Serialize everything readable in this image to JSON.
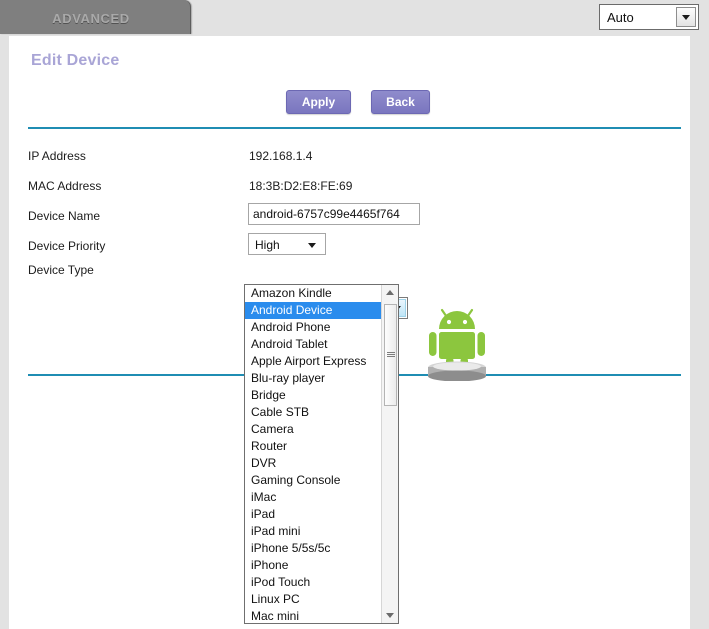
{
  "topbar": {
    "tab_label": "ADVANCED",
    "language_select": {
      "value": "Auto",
      "icon": "chevron-down-icon"
    }
  },
  "page": {
    "title": "Edit Device"
  },
  "toolbar": {
    "apply_label": "Apply",
    "back_label": "Back"
  },
  "form": {
    "rows": [
      {
        "label": "IP Address",
        "value": "192.168.1.4"
      },
      {
        "label": "MAC Address",
        "value": "18:3B:D2:E8:FE:69"
      },
      {
        "label": "Device Name",
        "value": "android-6757c99e4465f764"
      },
      {
        "label": "Device Priority",
        "value": "High"
      },
      {
        "label": "Device Type",
        "value": "Android Device"
      }
    ],
    "device_name_input": {
      "value": "android-6757c99e4465f764",
      "placeholder": ""
    },
    "device_priority_select": {
      "value": "High"
    },
    "device_type_select": {
      "value": "Android Device",
      "expanded": true,
      "options": [
        "Amazon Kindle",
        "Android Device",
        "Android Phone",
        "Android Tablet",
        "Apple Airport Express",
        "Blu-ray player",
        "Bridge",
        "Cable STB",
        "Camera",
        "Router",
        "DVR",
        "Gaming Console",
        "iMac",
        "iPad",
        "iPad mini",
        "iPhone 5/5s/5c",
        "iPhone",
        "iPod Touch",
        "Linux PC",
        "Mac mini"
      ],
      "selected_index": 1
    }
  },
  "device_image": {
    "icon": "android-robot-pedestal-icon",
    "body_color": "#8cc63e",
    "pedestal_color": "#9e9e9e"
  },
  "colors": {
    "accent_rule": "#1f8db3",
    "button": "#7a76bf",
    "title": "#a9a5d6",
    "tab_background": "#7f7f7f",
    "page_background": "#e2e2e2",
    "selection_highlight": "#2a8ced"
  }
}
